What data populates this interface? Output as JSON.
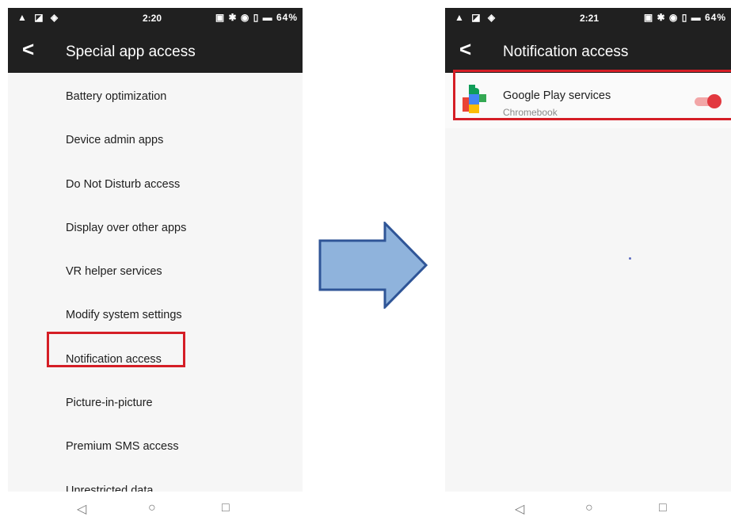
{
  "left_screen": {
    "status": {
      "left_icons": "▲ ◪ ◈",
      "time": "2:20",
      "right_icons": "▣ ✱ ◉ ▯ ▬ 64%"
    },
    "appbar": {
      "back": "<",
      "title": "Special app access"
    },
    "items": [
      {
        "label": "Battery optimization"
      },
      {
        "label": "Device admin apps"
      },
      {
        "label": "Do Not Disturb access"
      },
      {
        "label": "Display over other apps"
      },
      {
        "label": "VR helper services"
      },
      {
        "label": "Modify system settings"
      },
      {
        "label": "Notification access"
      },
      {
        "label": "Picture-in-picture"
      },
      {
        "label": "Premium SMS access"
      },
      {
        "label": "Unrestricted data"
      }
    ],
    "navbar": {
      "back": "◁",
      "home": "○",
      "recent": "□"
    }
  },
  "right_screen": {
    "status": {
      "left_icons": "▲ ◪ ◈",
      "time": "2:21",
      "right_icons": "▣ ✱ ◉ ▯ ▬ 64%"
    },
    "appbar": {
      "back": "<",
      "title": "Notification access"
    },
    "app": {
      "name": "Google Play services",
      "sub": "Chromebook",
      "toggle_on": true,
      "icon": "google-play-services-icon"
    },
    "navbar": {
      "back": "◁",
      "home": "○",
      "recent": "□"
    }
  },
  "colors": {
    "highlight": "#d51e26",
    "arrow_fill": "#8fb3dc",
    "arrow_stroke": "#2f5597",
    "toggle": "#e2383f"
  }
}
